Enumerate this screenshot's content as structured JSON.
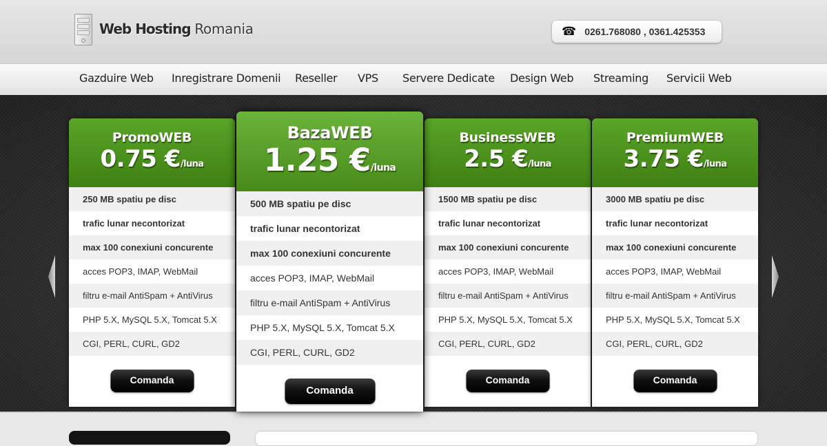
{
  "header": {
    "logo_bold": "Web Hosting",
    "logo_light": "Romania",
    "phone_icon": "telephone-icon",
    "phone": "0261.768080 , 0361.425353"
  },
  "nav": {
    "items": [
      {
        "label": "Gazduire Web"
      },
      {
        "label": "Inregistrare Domenii"
      },
      {
        "label": "Reseller"
      },
      {
        "label": "VPS"
      },
      {
        "label": "Servere Dedicate"
      },
      {
        "label": "Design Web"
      },
      {
        "label": "Streaming"
      },
      {
        "label": "Servicii Web"
      }
    ]
  },
  "slider": {
    "prev_icon": "arrow-left-icon",
    "next_icon": "arrow-right-icon"
  },
  "colors": {
    "accent_green": "#4a8f1e",
    "button_black": "#000000"
  },
  "plans": [
    {
      "name": "PromoWEB",
      "price": "0.75 €",
      "unit": "/luna",
      "features": [
        "250 MB spatiu pe disc",
        "trafic lunar necontorizat",
        "max 100 conexiuni concurente",
        "acces POP3, IMAP, WebMail",
        "filtru e-mail AntiSpam + AntiVirus",
        "PHP 5.X, MySQL 5.X, Tomcat 5.X",
        "CGI, PERL, CURL, GD2"
      ],
      "button": "Comanda"
    },
    {
      "name": "BazaWEB",
      "price": "1.25 €",
      "unit": "/luna",
      "featured": true,
      "features": [
        "500 MB spatiu pe disc",
        "trafic lunar necontorizat",
        "max 100 conexiuni concurente",
        "acces POP3, IMAP, WebMail",
        "filtru e-mail AntiSpam + AntiVirus",
        "PHP 5.X, MySQL 5.X, Tomcat 5.X",
        "CGI, PERL, CURL, GD2"
      ],
      "button": "Comanda"
    },
    {
      "name": "BusinessWEB",
      "price": "2.5 €",
      "unit": "/luna",
      "features": [
        "1500 MB spatiu pe disc",
        "trafic lunar necontorizat",
        "max 100 conexiuni concurente",
        "acces POP3, IMAP, WebMail",
        "filtru e-mail AntiSpam + AntiVirus",
        "PHP 5.X, MySQL 5.X, Tomcat 5.X",
        "CGI, PERL, CURL, GD2"
      ],
      "button": "Comanda"
    },
    {
      "name": "PremiumWEB",
      "price": "3.75 €",
      "unit": "/luna",
      "features": [
        "3000 MB spatiu pe disc",
        "trafic lunar necontorizat",
        "max 100 conexiuni concurente",
        "acces POP3, IMAP, WebMail",
        "filtru e-mail AntiSpam + AntiVirus",
        "PHP 5.X, MySQL 5.X, Tomcat 5.X",
        "CGI, PERL, CURL, GD2"
      ],
      "button": "Comanda"
    }
  ]
}
